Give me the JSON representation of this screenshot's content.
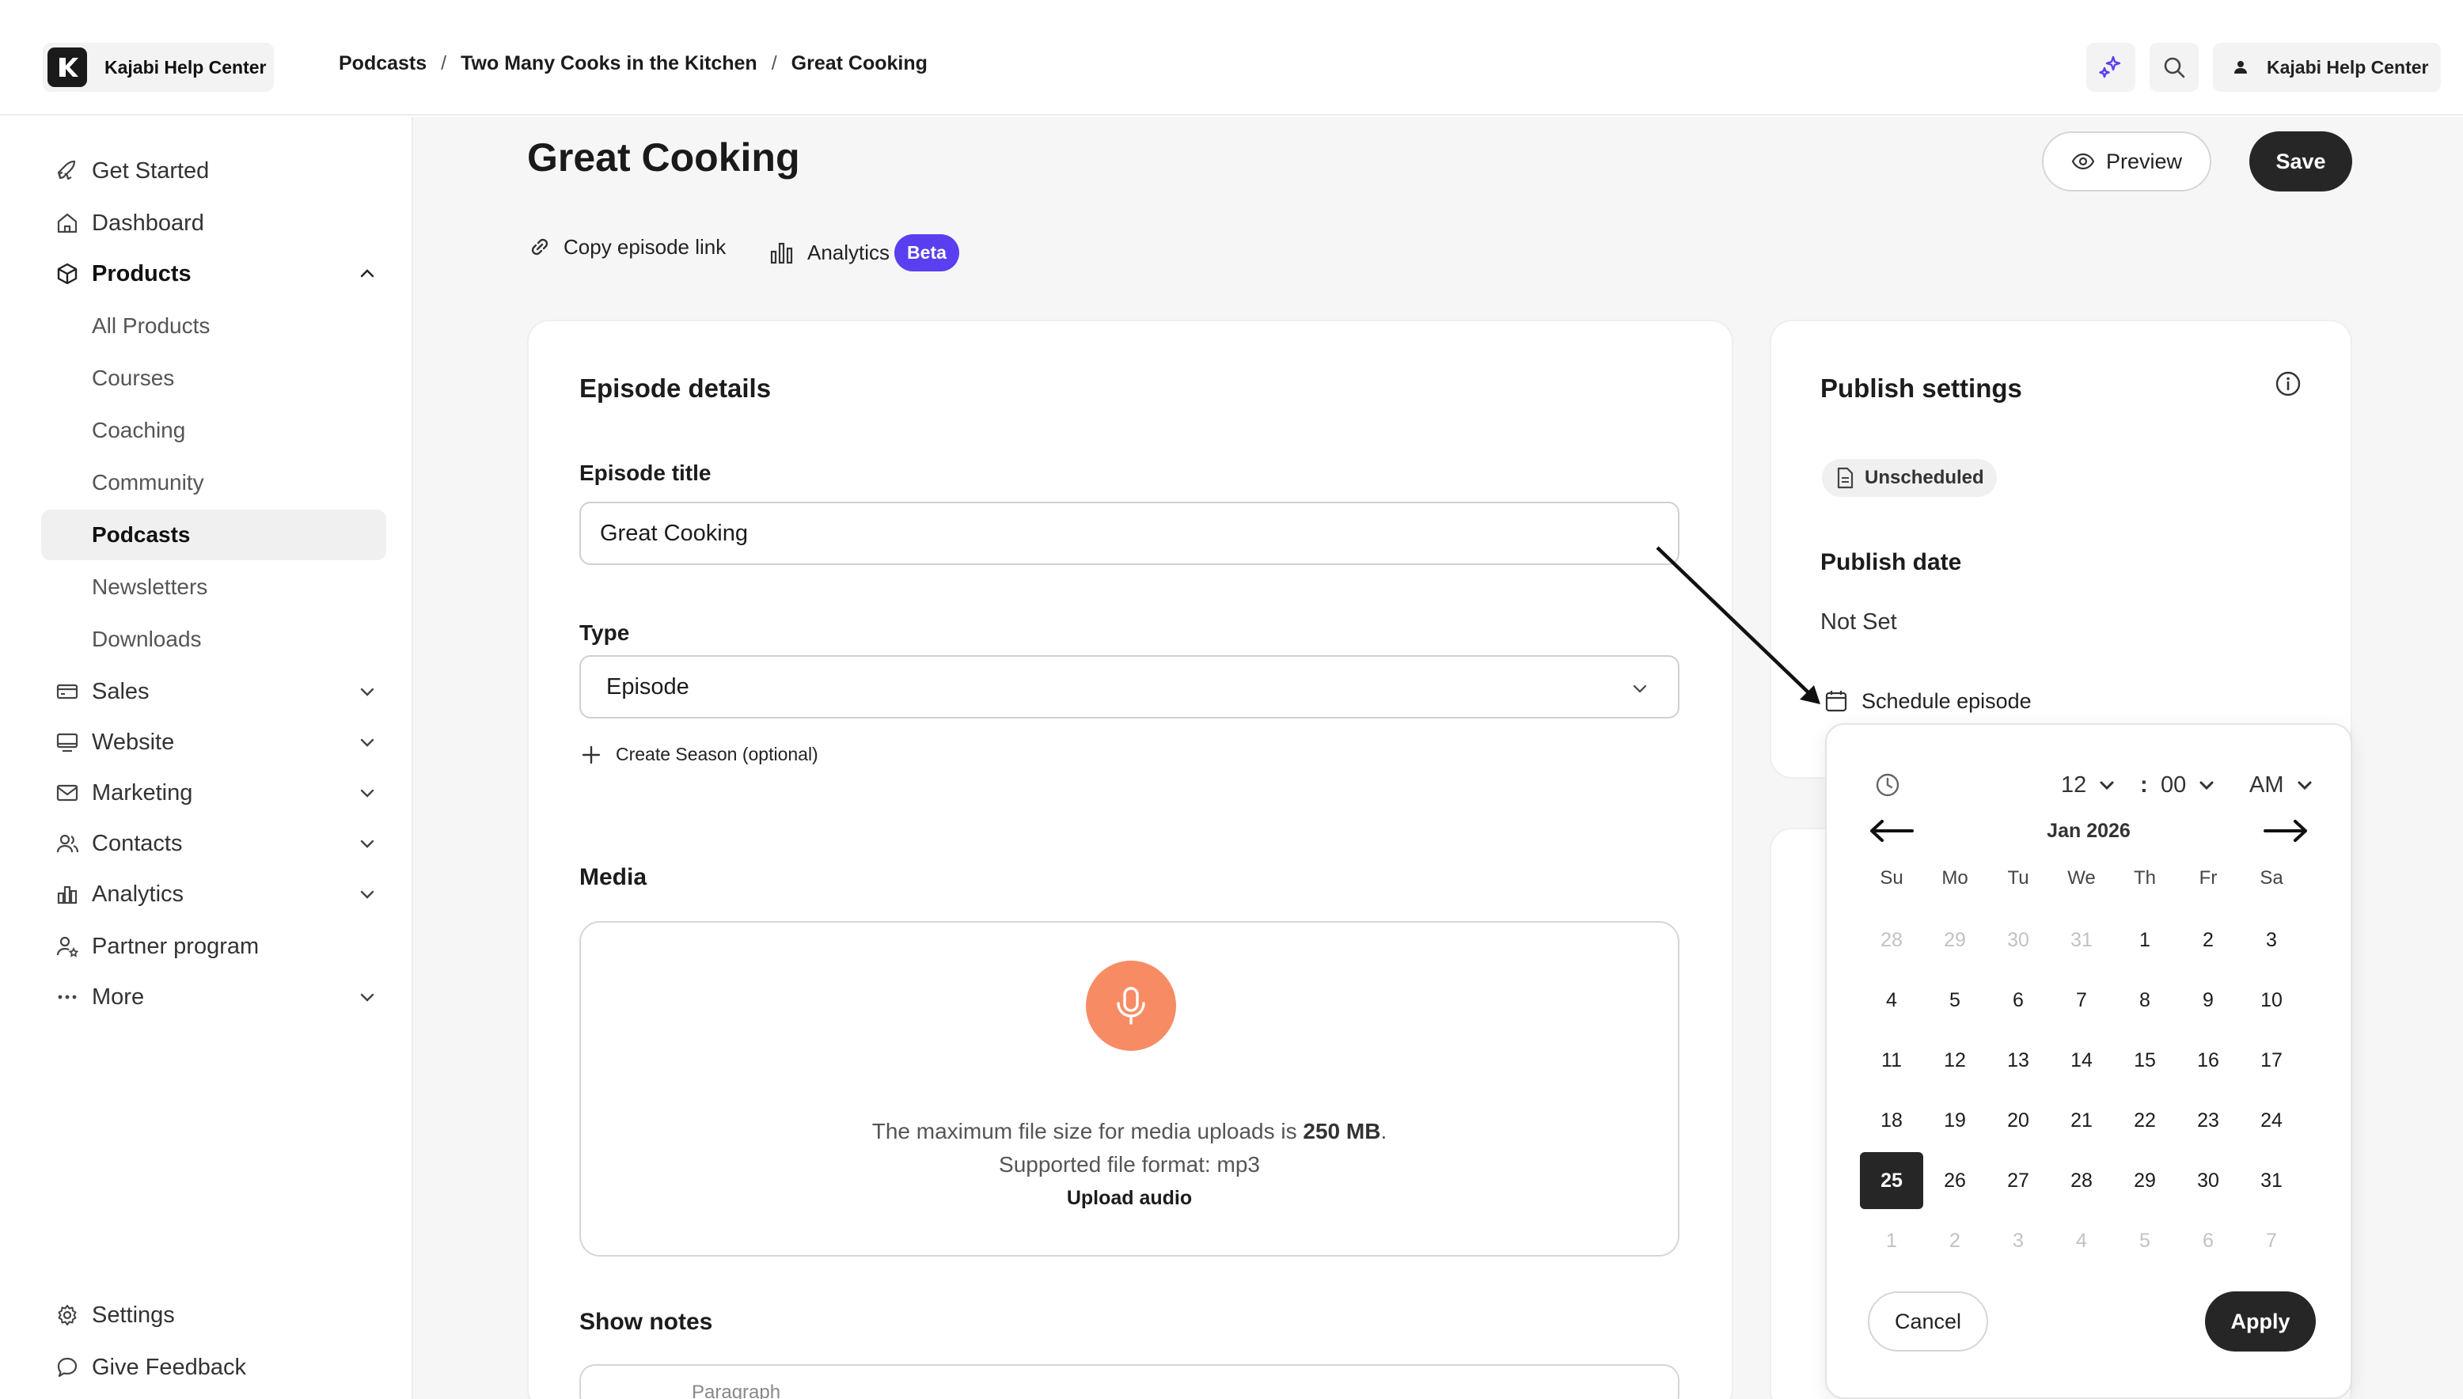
{
  "app": {
    "brand": "Kajabi Help Center"
  },
  "breadcrumb": [
    "Podcasts",
    "Two Many Cooks in the Kitchen",
    "Great Cooking"
  ],
  "topbar": {
    "user_label": "Kajabi Help Center",
    "icons": [
      "ai-sparkle-icon",
      "search-icon",
      "user-icon"
    ]
  },
  "sidebar": {
    "items": [
      {
        "label": "Get Started",
        "icon": "rocket-icon"
      },
      {
        "label": "Dashboard",
        "icon": "home-icon"
      },
      {
        "label": "Products",
        "icon": "box-icon",
        "expanded": true
      },
      {
        "label": "All Products"
      },
      {
        "label": "Courses"
      },
      {
        "label": "Coaching"
      },
      {
        "label": "Community"
      },
      {
        "label": "Podcasts",
        "active": true
      },
      {
        "label": "Newsletters"
      },
      {
        "label": "Downloads"
      },
      {
        "label": "Sales",
        "icon": "credit-card-icon"
      },
      {
        "label": "Website",
        "icon": "monitor-icon"
      },
      {
        "label": "Marketing",
        "icon": "mail-icon"
      },
      {
        "label": "Contacts",
        "icon": "contacts-icon"
      },
      {
        "label": "Analytics",
        "icon": "bar-chart-icon"
      },
      {
        "label": "Partner program",
        "icon": "partner-icon"
      },
      {
        "label": "More",
        "icon": "more-icon"
      }
    ],
    "bottom": [
      {
        "label": "Settings",
        "icon": "gear-icon"
      },
      {
        "label": "Give Feedback",
        "icon": "chat-bubble-icon"
      }
    ]
  },
  "page": {
    "title": "Great Cooking",
    "preview_label": "Preview",
    "save_label": "Save",
    "copy_link_label": "Copy episode link",
    "analytics_label": "Analytics",
    "beta_label": "Beta"
  },
  "episode": {
    "card_title": "Episode details",
    "title_label": "Episode title",
    "title_value": "Great Cooking",
    "type_label": "Type",
    "type_value": "Episode",
    "create_season_label": "Create Season (optional)",
    "media_label": "Media",
    "media_line1_prefix": "The maximum file size for media uploads is ",
    "media_line1_bold": "250 MB",
    "media_line1_suffix": ".",
    "media_line2": "Supported file format: mp3",
    "upload_label": "Upload audio",
    "show_notes_label": "Show notes",
    "editor_placeholder": "Paragraph"
  },
  "publish": {
    "card_title": "Publish settings",
    "status_badge": "Unscheduled",
    "date_label": "Publish date",
    "date_value": "Not Set",
    "schedule_label": "Schedule episode"
  },
  "datepicker": {
    "hour": "12",
    "minute": "00",
    "time_separator": ":",
    "meridiem": "AM",
    "month_label": "Jan 2026",
    "weekdays": [
      "Su",
      "Mo",
      "Tu",
      "We",
      "Th",
      "Fr",
      "Sa"
    ],
    "days": [
      {
        "d": "28",
        "muted": true
      },
      {
        "d": "29",
        "muted": true
      },
      {
        "d": "30",
        "muted": true
      },
      {
        "d": "31",
        "muted": true
      },
      {
        "d": "1"
      },
      {
        "d": "2"
      },
      {
        "d": "3"
      },
      {
        "d": "4"
      },
      {
        "d": "5"
      },
      {
        "d": "6"
      },
      {
        "d": "7"
      },
      {
        "d": "8"
      },
      {
        "d": "9"
      },
      {
        "d": "10"
      },
      {
        "d": "11"
      },
      {
        "d": "12"
      },
      {
        "d": "13"
      },
      {
        "d": "14"
      },
      {
        "d": "15"
      },
      {
        "d": "16"
      },
      {
        "d": "17"
      },
      {
        "d": "18"
      },
      {
        "d": "19"
      },
      {
        "d": "20"
      },
      {
        "d": "21"
      },
      {
        "d": "22"
      },
      {
        "d": "23"
      },
      {
        "d": "24"
      },
      {
        "d": "25",
        "selected": true
      },
      {
        "d": "26"
      },
      {
        "d": "27"
      },
      {
        "d": "28"
      },
      {
        "d": "29"
      },
      {
        "d": "30"
      },
      {
        "d": "31"
      },
      {
        "d": "1",
        "muted": true
      },
      {
        "d": "2",
        "muted": true
      },
      {
        "d": "3",
        "muted": true
      },
      {
        "d": "4",
        "muted": true
      },
      {
        "d": "5",
        "muted": true
      },
      {
        "d": "6",
        "muted": true
      },
      {
        "d": "7",
        "muted": true
      }
    ],
    "cancel_label": "Cancel",
    "apply_label": "Apply"
  },
  "colors": {
    "accent": "#5a3ff0",
    "primary_button": "#262626",
    "mic": "#f78c64"
  }
}
